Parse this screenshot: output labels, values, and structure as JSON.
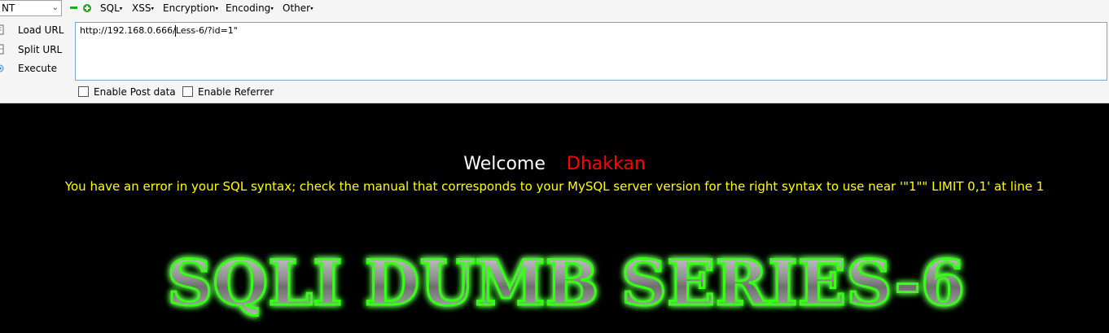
{
  "toolbar": {
    "dropdown_value": "NT",
    "menu": {
      "sql": "SQL",
      "xss": "XSS",
      "encryption": "Encryption",
      "encoding": "Encoding",
      "other": "Other"
    },
    "actions": {
      "load_url": "Load URL",
      "split_url": "Split URL",
      "execute": "Execute"
    },
    "url_value": "http://192.168.0.666/Less-6/?id=1\"",
    "checkboxes": {
      "post": "Enable Post data",
      "referrer": "Enable Referrer"
    }
  },
  "page": {
    "welcome": "Welcome",
    "name": "Dhakkan",
    "error": "You have an error in your SQL syntax; check the manual that corresponds to your MySQL server version for the right syntax to use near '\"1\"\" LIMIT 0,1' at line 1",
    "banner": "SQLI DUMB SERIES-6"
  },
  "colors": {
    "accent_green": "#22cc22",
    "welcome": "#ffffff",
    "name": "#ff0000",
    "error": "#ffff00",
    "banner_glow": "#39ff14"
  },
  "icons": {
    "minus": "minus-icon",
    "plus": "plus-icon",
    "load": "load-url-icon",
    "split": "split-url-icon",
    "execute": "execute-icon"
  }
}
